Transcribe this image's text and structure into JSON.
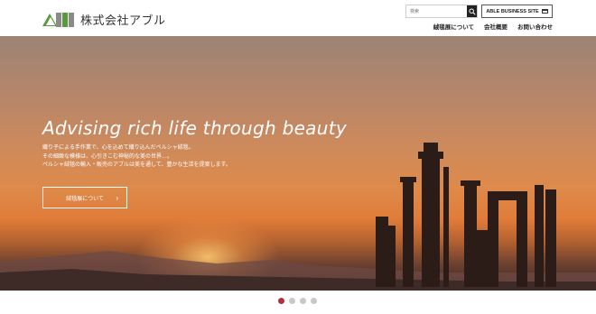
{
  "header": {
    "logo_text": "株式会社アブル",
    "search": {
      "placeholder": "検索",
      "value": ""
    },
    "business_site_label": "ABLE BUSINESS SITE",
    "nav": [
      {
        "label": "絨毯展について"
      },
      {
        "label": "会社概要"
      },
      {
        "label": "お問い合わせ"
      }
    ]
  },
  "hero": {
    "title": "Advising rich life through beauty",
    "copy": [
      "織り子による手作業で、心を込めて織り込んだペルシャ絨毯。",
      "その細緻な模様は、心引きこむ神秘的な美の世界…。",
      "ペルシャ絨毯の輸入・販売のアブルは美を通して、豊かな生活を提案します。"
    ],
    "button_label": "絨毯展について"
  },
  "slider": {
    "dots": 4,
    "active_index": 0
  },
  "colors": {
    "accent_green": "#5a9a3c",
    "active_dot": "#b03040"
  }
}
